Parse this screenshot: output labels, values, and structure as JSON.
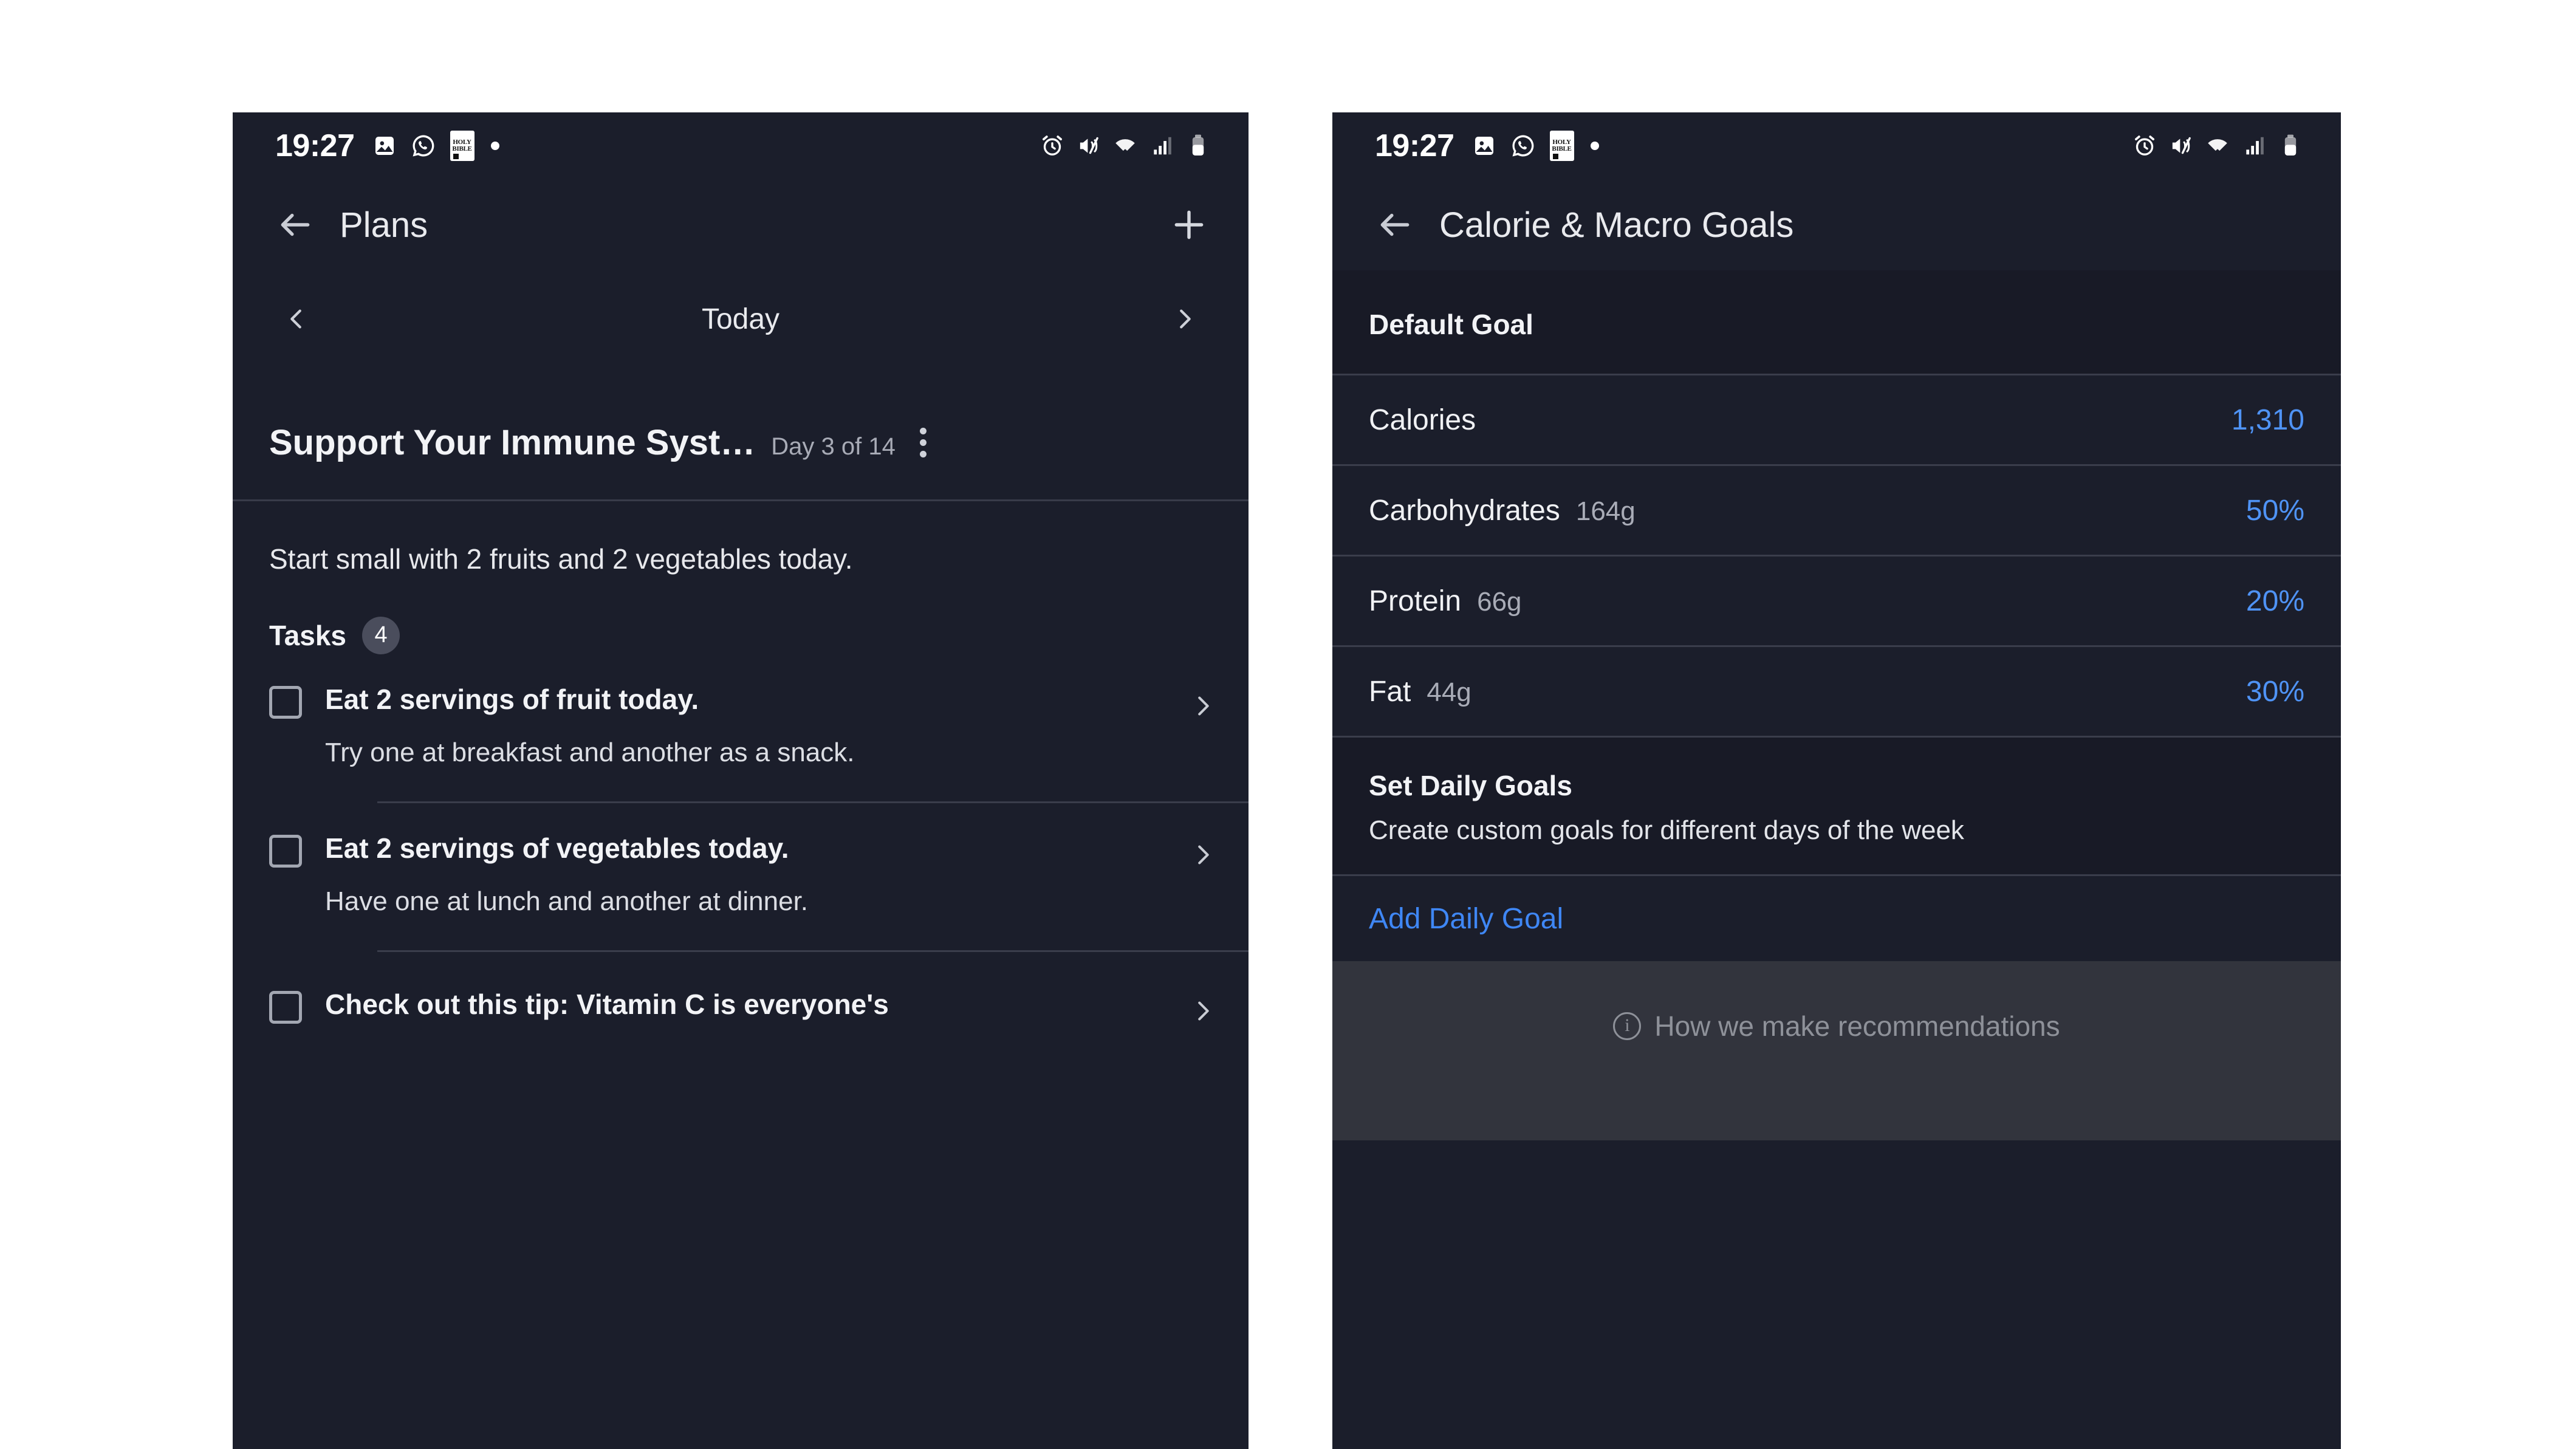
{
  "status_bar": {
    "time": "19:27",
    "left_icons": [
      "photo-icon",
      "whatsapp-icon",
      "bible-icon",
      "dot-indicator"
    ],
    "bible_line1": "HOLY",
    "bible_line2": "BIBLE",
    "right_icons": [
      "alarm-icon",
      "mute-icon",
      "wifi-icon",
      "signal-icon",
      "battery-icon"
    ]
  },
  "left_screen": {
    "nav": {
      "back_icon": "arrow-left-icon",
      "title": "Plans",
      "add_icon": "plus-icon"
    },
    "date_strip": {
      "prev_icon": "chevron-left-icon",
      "label": "Today",
      "next_icon": "chevron-right-icon"
    },
    "plan": {
      "title": "Support Your Immune Syst…",
      "day_label": "Day 3 of 14",
      "menu_icon": "kebab-menu-icon",
      "description": "Start small with 2 fruits and 2 vegetables today."
    },
    "tasks_header": {
      "label": "Tasks",
      "count": "4"
    },
    "tasks": [
      {
        "title": "Eat 2 servings of fruit today.",
        "subtitle": "Try one at breakfast and another as a snack.",
        "checked": false,
        "chevron_icon": "chevron-right-icon"
      },
      {
        "title": "Eat 2 servings of vegetables today.",
        "subtitle": "Have one at lunch and another at dinner.",
        "checked": false,
        "chevron_icon": "chevron-right-icon"
      },
      {
        "title": "Check out this tip: Vitamin C is everyone's",
        "subtitle": "",
        "checked": false,
        "chevron_icon": "chevron-right-icon"
      }
    ]
  },
  "right_screen": {
    "nav": {
      "back_icon": "arrow-left-icon",
      "title": "Calorie & Macro Goals"
    },
    "default_goal": {
      "heading": "Default Goal",
      "rows": [
        {
          "name": "Calories",
          "grams": "",
          "value": "1,310"
        },
        {
          "name": "Carbohydrates",
          "grams": "164g",
          "value": "50%"
        },
        {
          "name": "Protein",
          "grams": "66g",
          "value": "20%"
        },
        {
          "name": "Fat",
          "grams": "44g",
          "value": "30%"
        }
      ]
    },
    "set_daily_goals": {
      "heading": "Set Daily Goals",
      "subtitle": "Create custom goals for different days of the week",
      "add_link": "Add Daily Goal"
    },
    "footer": {
      "info_icon": "info-circle-icon",
      "glyph": "i",
      "label": "How we make recommendations"
    }
  },
  "colors": {
    "panel_bg": "#1b1e2b",
    "section_bg": "#181a26",
    "accent_blue": "#4f93f5",
    "footer_bg": "#32343d",
    "divider": "#3a3d4b"
  }
}
